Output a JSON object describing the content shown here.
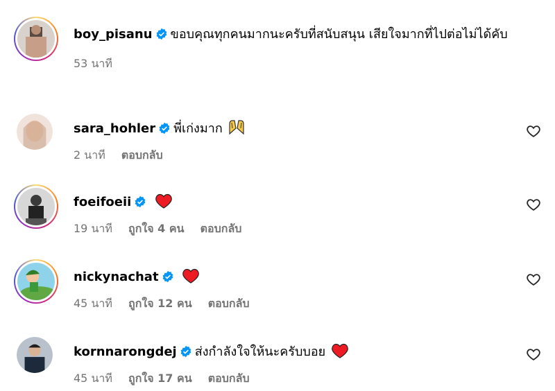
{
  "comments": [
    {
      "username": "boy_pisanu",
      "text": "ขอบคุณทุกคนมากนะครับที่สนับสนุน เสียใจมากที่ไปต่อไม่ได้คับ",
      "time": "53 นาที",
      "likes": "",
      "reply": "",
      "emoji": ""
    },
    {
      "username": "sara_hohler",
      "text": "พี่เก่งมาก",
      "time": "2 นาที",
      "likes": "",
      "reply": "ตอบกลับ",
      "emoji": "raised-hands-icon"
    },
    {
      "username": "foeifoeii",
      "text": "",
      "time": "19 นาที",
      "likes": "ถูกใจ 4 คน",
      "reply": "ตอบกลับ",
      "emoji": "red-heart-icon"
    },
    {
      "username": "nickynachat",
      "text": "",
      "time": "45 นาที",
      "likes": "ถูกใจ 12 คน",
      "reply": "ตอบกลับ",
      "emoji": "red-heart-icon"
    },
    {
      "username": "kornnarongdej",
      "text": "ส่งกำลังใจให้นะครับบอย",
      "time": "45 นาที",
      "likes": "ถูกใจ 17 คน",
      "reply": "ตอบกลับ",
      "emoji": "red-heart-icon"
    }
  ],
  "colors": {
    "verified": "#0095f6",
    "heart": "#ed1c24",
    "meta": "#737373"
  }
}
